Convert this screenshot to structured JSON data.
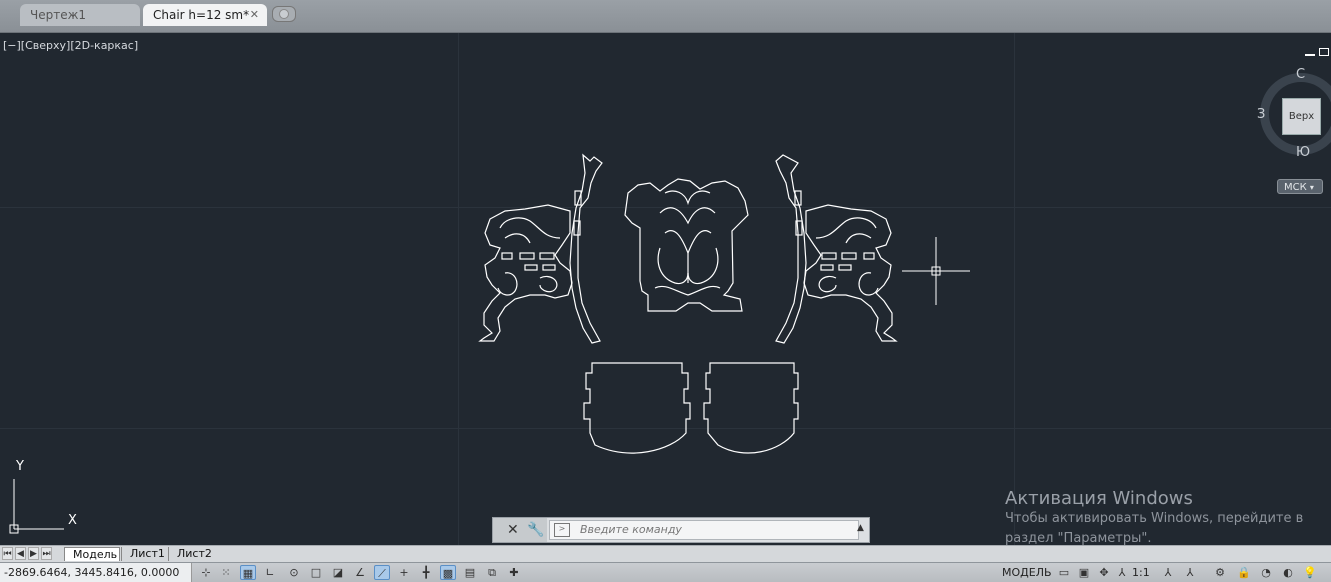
{
  "tabs": [
    {
      "label": "Чертеж1"
    },
    {
      "label": "Chair h=12 sm*",
      "close": "✕"
    }
  ],
  "viewport": {
    "label": "[−][Сверху][2D-каркас]"
  },
  "viewcube": {
    "face": "Верх",
    "north": "С",
    "south": "Ю",
    "west": "З",
    "wcs": "МСК"
  },
  "ucs": {
    "x": "X",
    "y": "Y"
  },
  "command": {
    "placeholder": "Введите команду"
  },
  "activation": {
    "title": "Активация Windows",
    "line1": "Чтобы активировать Windows, перейдите в",
    "line2": "раздел \"Параметры\"."
  },
  "layout_tabs": [
    {
      "label": "Модель",
      "active": true
    },
    {
      "label": "Лист1",
      "active": false
    },
    {
      "label": "Лист2",
      "active": false
    }
  ],
  "status": {
    "coordinates": "-2869.6464, 3445.8416, 0.0000",
    "model": "МОДЕЛЬ",
    "scale": "1:1"
  },
  "colors": {
    "background": "#212830",
    "linework": "#ffffff",
    "active_toggle": "#a9c9e9"
  }
}
